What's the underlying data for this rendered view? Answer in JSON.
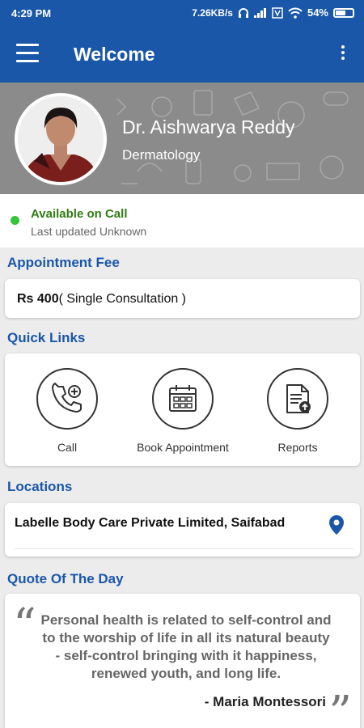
{
  "status_bar": {
    "time": "4:29 PM",
    "network_speed": "7.26KB/s",
    "battery": "54%"
  },
  "app_bar": {
    "title": "Welcome"
  },
  "profile": {
    "name": "Dr. Aishwarya Reddy",
    "specialty": "Dermatology"
  },
  "availability": {
    "status": "Available on Call",
    "updated": "Last updated Unknown",
    "status_color": "#35c435"
  },
  "fee": {
    "heading": "Appointment Fee",
    "amount": "Rs 400",
    "detail": "( Single Consultation )"
  },
  "quick_links": {
    "heading": "Quick Links",
    "items": [
      {
        "label": "Call",
        "icon": "phone-plus-icon"
      },
      {
        "label": "Book Appointment",
        "icon": "calendar-icon"
      },
      {
        "label": "Reports",
        "icon": "report-upload-icon"
      }
    ]
  },
  "locations": {
    "heading": "Locations",
    "items": [
      {
        "name": "Labelle Body Care Private Limited, Saifabad",
        "icon": "map-pin-icon"
      }
    ]
  },
  "quote": {
    "heading": "Quote Of The Day",
    "text": "Personal health is related to self-control and to the worship of life in all its natural beauty - self-control bringing with it happiness, renewed youth, and long life.",
    "author": "- Maria Montessori"
  },
  "colors": {
    "primary": "#1a57a8",
    "header_bg": "#8b8b8b",
    "page_bg": "#ececec"
  }
}
